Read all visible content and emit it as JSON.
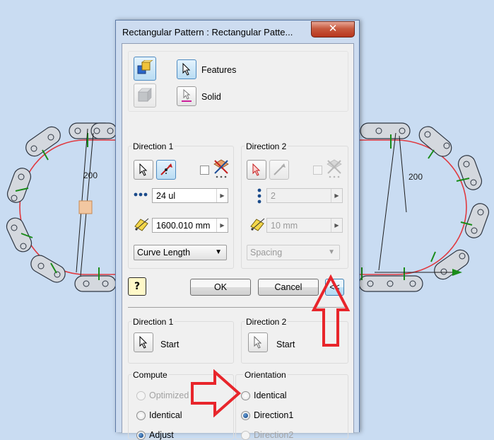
{
  "window": {
    "title": "Rectangular Pattern : Rectangular Patte...",
    "close_glyph": "✕"
  },
  "background": {
    "dimension_left": "200",
    "dimension_right": "200"
  },
  "selection": {
    "features_label": "Features",
    "solid_label": "Solid"
  },
  "direction1": {
    "title": "Direction 1",
    "count_value": "24 ul",
    "distance_value": "1600.010 mm",
    "method_value": "Curve Length"
  },
  "direction2": {
    "title": "Direction 2",
    "count_value": "2",
    "distance_value": "10 mm",
    "method_value": "Spacing"
  },
  "buttons": {
    "ok_label": "OK",
    "cancel_label": "Cancel",
    "collapse_label": "<<",
    "help_glyph": "?"
  },
  "start": {
    "d1_title": "Direction 1",
    "d1_label": "Start",
    "d2_title": "Direction 2",
    "d2_label": "Start"
  },
  "compute": {
    "title": "Compute",
    "options": [
      "Optimized",
      "Identical",
      "Adjust"
    ]
  },
  "orientation": {
    "title": "Orientation",
    "options": [
      "Identical",
      "Direction1",
      "Direction2"
    ]
  },
  "colors": {
    "path": "#e0393f",
    "annotation_arrow": "#e8252b",
    "link_marker": "#1a8c1a",
    "titlebar": "#cddcf0",
    "close_button": "#c75a3f"
  }
}
